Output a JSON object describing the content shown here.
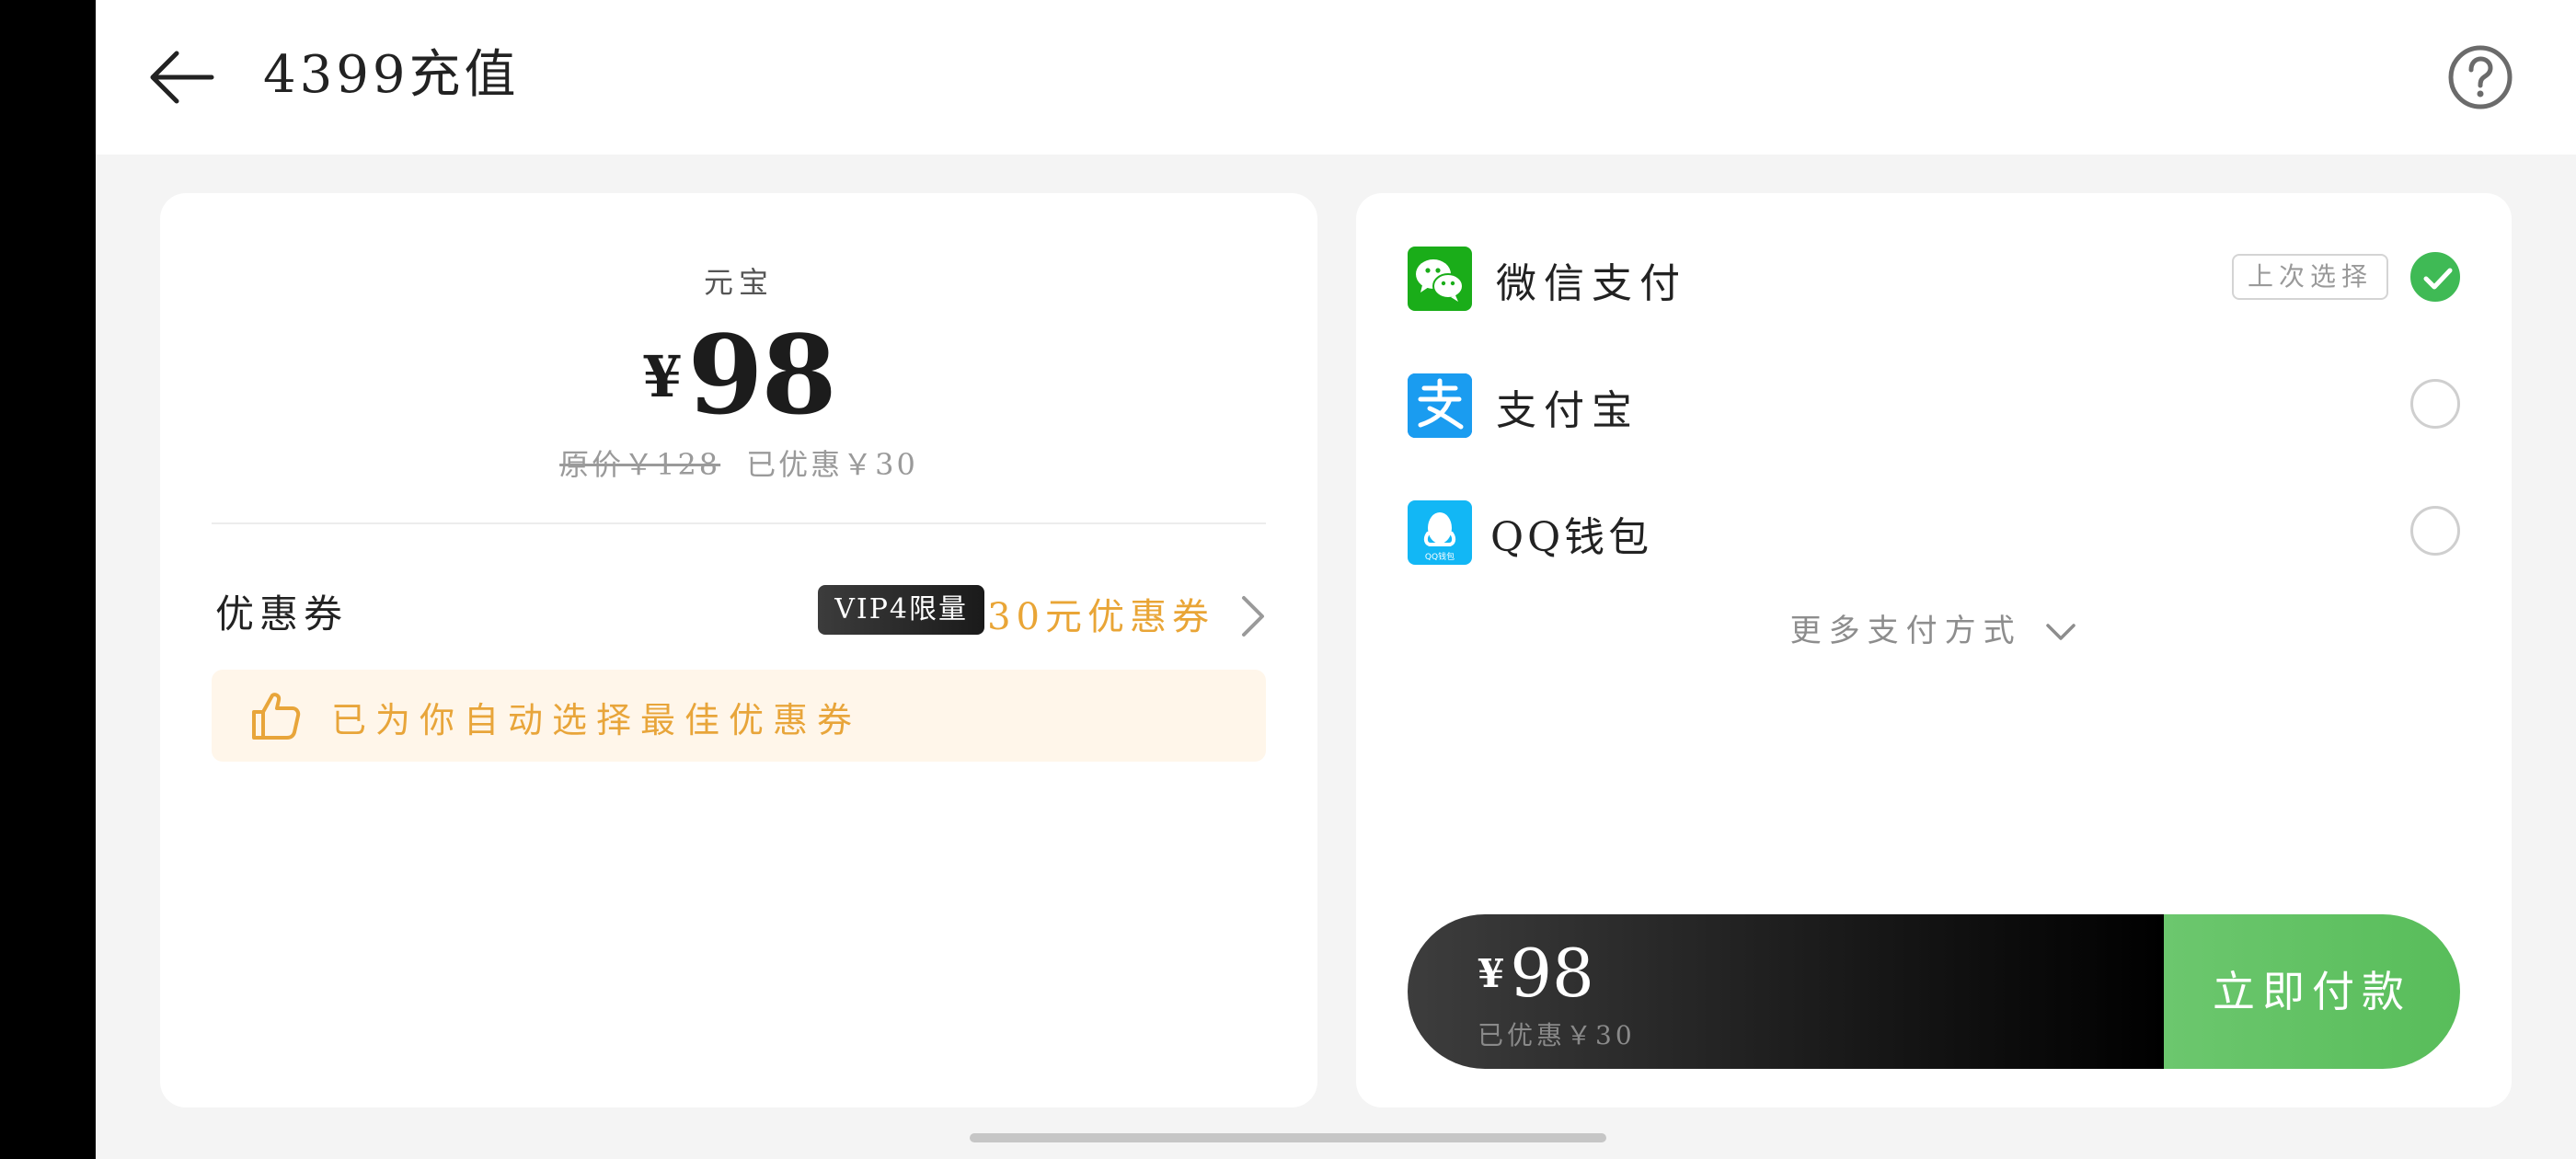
{
  "header": {
    "title": "4399充值",
    "back_icon": "arrow-left-icon",
    "help_icon": "question-circle-icon"
  },
  "product": {
    "name": "元宝",
    "currency": "¥",
    "price": "98",
    "original_price_text": "原价￥128",
    "discount_text": "已优惠￥30"
  },
  "coupon": {
    "label": "优惠券",
    "badge": "VIP4限量",
    "value": "30元优惠券",
    "tip": "已为你自动选择最佳优惠券"
  },
  "payment": {
    "methods": [
      {
        "name": "微信支付",
        "icon": "wechat-pay-icon",
        "tag": "上次选择",
        "selected": true
      },
      {
        "name": "支付宝",
        "icon": "alipay-icon",
        "selected": false
      },
      {
        "name": "QQ钱包",
        "icon": "qq-wallet-icon",
        "icon_text": "QQ钱包",
        "selected": false
      }
    ],
    "more_label": "更多支付方式"
  },
  "pay_bar": {
    "currency": "¥",
    "amount": "98",
    "discount_text": "已优惠￥30",
    "pay_button": "立即付款"
  },
  "colors": {
    "accent_orange": "#e9a536",
    "wechat_green": "#1aad19",
    "alipay_blue": "#1677ff",
    "qq_blue": "#12b7f5",
    "check_green": "#3fba55",
    "pay_green": "#62c364"
  }
}
